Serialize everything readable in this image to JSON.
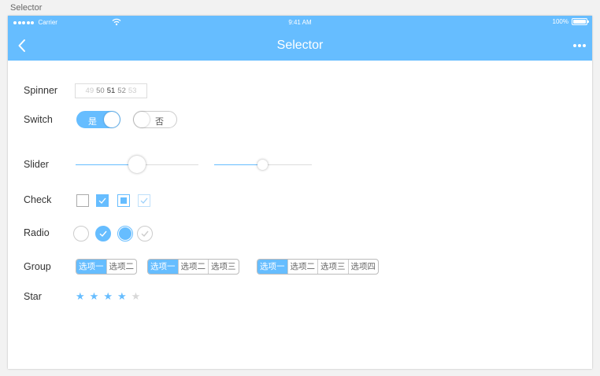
{
  "page_label": "Selector",
  "statusbar": {
    "carrier": "Carrier",
    "time": "9:41 AM",
    "battery": "100%"
  },
  "navbar": {
    "title": "Selector",
    "back_icon": "chevron-left-icon",
    "more_icon": "more-dots-icon"
  },
  "rows": {
    "spinner": {
      "label": "Spinner",
      "values": [
        "49",
        "50",
        "51",
        "52",
        "53"
      ],
      "selected": "51"
    },
    "switch": {
      "label": "Switch",
      "on_text": "是",
      "off_text": "否"
    },
    "slider": {
      "label": "Slider"
    },
    "check": {
      "label": "Check"
    },
    "radio": {
      "label": "Radio"
    },
    "group": {
      "label": "Group",
      "groups": [
        [
          "选项一",
          "选项二"
        ],
        [
          "选项一",
          "选项二",
          "选项三"
        ],
        [
          "选项一",
          "选项二",
          "选项三",
          "选项四"
        ]
      ]
    },
    "star": {
      "label": "Star",
      "value": 4,
      "max": 5
    }
  },
  "colors": {
    "accent": "#66bdff"
  }
}
